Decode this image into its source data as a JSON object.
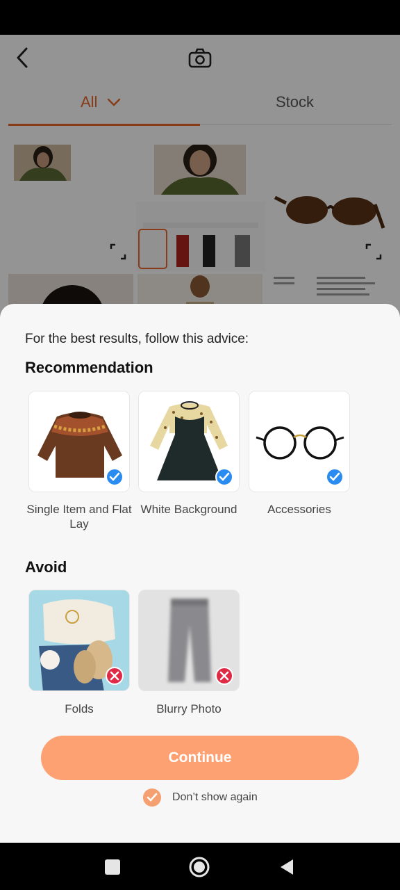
{
  "header": {
    "back_icon": "chevron-left-icon",
    "camera_icon": "camera-icon"
  },
  "tabs": [
    {
      "label": "All",
      "active": true,
      "icon": "chevron-down-icon"
    },
    {
      "label": "Stock",
      "active": false
    }
  ],
  "colors": {
    "accent": "#e8672a",
    "button": "#fea172",
    "check_ok": "#2a8cf0",
    "check_bad": "#e02a45"
  },
  "sheet": {
    "advice": "For the best results, follow this advice:",
    "recommendation_title": "Recommendation",
    "recommendations": [
      {
        "label": "Single Item and Flat Lay",
        "image": "sweater-image",
        "status": "check-icon"
      },
      {
        "label": "White Background",
        "image": "dress-image",
        "status": "check-icon"
      },
      {
        "label": "Accessories",
        "image": "glasses-image",
        "status": "check-icon"
      }
    ],
    "avoid_title": "Avoid",
    "avoids": [
      {
        "label": "Folds",
        "image": "folded-clothes-image",
        "status": "x-icon"
      },
      {
        "label": "Blurry Photo",
        "image": "blurry-pants-image",
        "status": "x-icon"
      }
    ],
    "continue_label": "Continue",
    "dont_show_label": "Don’t show again",
    "dont_show_checked": true
  },
  "nav": {
    "recent_icon": "square-icon",
    "home_icon": "circle-icon",
    "back_icon": "triangle-back-icon"
  }
}
